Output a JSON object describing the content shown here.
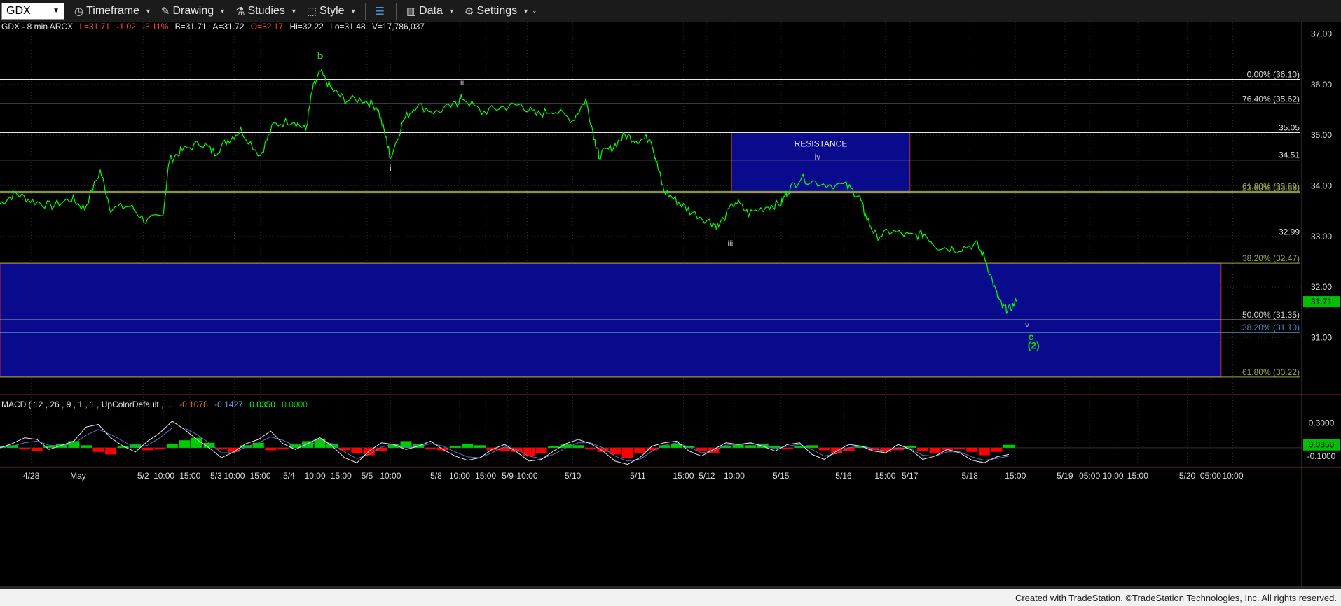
{
  "toolbar": {
    "symbol": "GDX",
    "timeframe_label": "Timeframe",
    "drawing_label": "Drawing",
    "studies_label": "Studies",
    "style_label": "Style",
    "data_label": "Data",
    "settings_label": "Settings"
  },
  "header": {
    "name": "GDX - 8 min  ARCX",
    "last": "L=31.71",
    "change": "-1.02",
    "pct": "-3.11%",
    "bid": "B=31.71",
    "ask": "A=31.72",
    "open": "O=32.17",
    "high": "Hi=32.22",
    "low": "Lo=31.48",
    "volume": "V=17,786,037"
  },
  "macd_header": {
    "label": "MACD ( 12 , 26 , 9 , 1 , 1 , UpColorDefault , ...",
    "v1": "-0.1078",
    "v2": "-0.1427",
    "v3": "0.0350",
    "v4": "0.0000"
  },
  "footer": {
    "text": "Created with TradeStation. ©TradeStation Technologies, Inc. All rights reserved."
  },
  "colors": {
    "price": "#00ff00",
    "zone": "#0a0a8c",
    "zone_border": "#c03030",
    "hist_up": "#00cc00",
    "hist_down": "#ff0000"
  },
  "chart_data": {
    "type": "line",
    "title": "GDX - 8 min",
    "ylim": [
      29.9,
      37.2
    ],
    "y_ticks": [
      {
        "value": 37.0,
        "label": "37.00"
      },
      {
        "value": 36.0,
        "label": "36.00"
      },
      {
        "value": 35.0,
        "label": "35.00"
      },
      {
        "value": 34.0,
        "label": "34.00"
      },
      {
        "value": 33.0,
        "label": "33.00"
      },
      {
        "value": 32.0,
        "label": "32.00"
      },
      {
        "value": 31.0,
        "label": "31.00"
      }
    ],
    "last_price": {
      "value": 31.71,
      "label": "31.71"
    },
    "x_ticks": [
      "4/28",
      "May",
      "5/2",
      "10:00",
      "15:00",
      "5/3",
      "10:00",
      "15:00",
      "5/4",
      "10:00",
      "15:00",
      "5/5",
      "10:00",
      "5/8",
      "10:00",
      "15:00",
      "5/9",
      "10:00",
      "5/10",
      "5/11",
      "15:00",
      "5/12",
      "10:00",
      "5/15",
      "5/16",
      "15:00",
      "5/17",
      "5/18",
      "15:00",
      "5/19",
      "05:00",
      "10:00",
      "15:00",
      "5/20",
      "05:00",
      "10:00"
    ],
    "series": [
      {
        "values": [
          [
            0,
            33.65
          ],
          [
            0.012,
            33.85
          ],
          [
            0.025,
            33.7
          ],
          [
            0.04,
            33.6
          ],
          [
            0.055,
            33.75
          ],
          [
            0.065,
            33.55
          ],
          [
            0.077,
            34.3
          ],
          [
            0.085,
            33.55
          ],
          [
            0.1,
            33.6
          ],
          [
            0.112,
            33.3
          ],
          [
            0.125,
            33.4
          ],
          [
            0.13,
            34.5
          ],
          [
            0.14,
            34.7
          ],
          [
            0.155,
            34.85
          ],
          [
            0.165,
            34.65
          ],
          [
            0.175,
            34.9
          ],
          [
            0.185,
            35.1
          ],
          [
            0.2,
            34.6
          ],
          [
            0.21,
            35.2
          ],
          [
            0.225,
            35.3
          ],
          [
            0.235,
            35.1
          ],
          [
            0.24,
            35.9
          ],
          [
            0.246,
            36.25
          ],
          [
            0.255,
            35.9
          ],
          [
            0.265,
            35.7
          ],
          [
            0.28,
            35.7
          ],
          [
            0.29,
            35.55
          ],
          [
            0.297,
            34.9
          ],
          [
            0.3,
            34.55
          ],
          [
            0.31,
            35.3
          ],
          [
            0.32,
            35.6
          ],
          [
            0.335,
            35.45
          ],
          [
            0.35,
            35.6
          ],
          [
            0.355,
            35.75
          ],
          [
            0.37,
            35.45
          ],
          [
            0.385,
            35.55
          ],
          [
            0.4,
            35.6
          ],
          [
            0.412,
            35.4
          ],
          [
            0.425,
            35.5
          ],
          [
            0.44,
            35.3
          ],
          [
            0.45,
            35.7
          ],
          [
            0.457,
            34.9
          ],
          [
            0.46,
            34.6
          ],
          [
            0.47,
            34.75
          ],
          [
            0.48,
            35.0
          ],
          [
            0.49,
            34.9
          ],
          [
            0.5,
            34.95
          ],
          [
            0.504,
            34.5
          ],
          [
            0.51,
            33.9
          ],
          [
            0.52,
            33.7
          ],
          [
            0.53,
            33.5
          ],
          [
            0.545,
            33.3
          ],
          [
            0.552,
            33.2
          ],
          [
            0.565,
            33.7
          ],
          [
            0.575,
            33.45
          ],
          [
            0.59,
            33.6
          ],
          [
            0.6,
            33.65
          ],
          [
            0.605,
            33.9
          ],
          [
            0.615,
            34.15
          ],
          [
            0.63,
            34.05
          ],
          [
            0.65,
            34.0
          ],
          [
            0.66,
            33.8
          ],
          [
            0.665,
            33.4
          ],
          [
            0.673,
            33.0
          ],
          [
            0.685,
            33.1
          ],
          [
            0.7,
            33.0
          ],
          [
            0.71,
            33.05
          ],
          [
            0.72,
            32.8
          ],
          [
            0.735,
            32.75
          ],
          [
            0.75,
            32.85
          ],
          [
            0.757,
            32.55
          ],
          [
            0.765,
            31.9
          ],
          [
            0.77,
            31.6
          ],
          [
            0.775,
            31.55
          ],
          [
            0.781,
            31.71
          ]
        ]
      }
    ],
    "horizontal_levels": [
      {
        "value": 36.1,
        "label": "0.00% (36.10)",
        "color": "#e8e8e8"
      },
      {
        "value": 35.62,
        "label": "76.40% (35.62)",
        "color": "#e8e8e8"
      },
      {
        "value": 35.05,
        "label": "35.05",
        "color": "#e8e8e8"
      },
      {
        "value": 34.51,
        "label": "34.51",
        "color": "#e8e8e8"
      },
      {
        "value": 33.89,
        "label": "61.80% (33.89)",
        "color": "#9aa84a"
      },
      {
        "value": 33.86,
        "label": "23.60% (33.86)",
        "color": "#9aa84a"
      },
      {
        "value": 32.99,
        "label": "32.99",
        "color": "#e8e8e8"
      },
      {
        "value": 32.47,
        "label": "38.20% (32.47)",
        "color": "#9aa84a"
      },
      {
        "value": 31.35,
        "label": "50.00% (31.35)",
        "color": "#cfcfcf"
      },
      {
        "value": 31.1,
        "label": "38.20% (31.10)",
        "color": "#4a90c0"
      },
      {
        "value": 30.22,
        "label": "61.80% (30.22)",
        "color": "#9aa84a"
      }
    ],
    "zones": [
      {
        "label": "RESISTANCE",
        "x_from": 0.562,
        "x_to": 0.699,
        "y_from": 33.86,
        "y_to": 35.05
      },
      {
        "label": "",
        "x_from": 0.0,
        "x_to": 0.938,
        "y_from": 30.22,
        "y_to": 32.47
      }
    ],
    "annotations": [
      {
        "text": "b",
        "x": 0.246,
        "y": 36.5,
        "color": "#3fbf3f"
      },
      {
        "text": "ii",
        "x": 0.355,
        "y": 35.98,
        "color": "#bbbbbb"
      },
      {
        "text": "i",
        "x": 0.3,
        "y": 34.3,
        "color": "#bbbbbb"
      },
      {
        "text": "iv",
        "x": 0.628,
        "y": 34.52,
        "color": "#bbbbbb"
      },
      {
        "text": "iii",
        "x": 0.561,
        "y": 32.8,
        "color": "#bbbbbb"
      },
      {
        "text": "v",
        "x": 0.789,
        "y": 31.2,
        "color": "#bbbbbb"
      },
      {
        "text": "c",
        "x": 0.792,
        "y": 30.95,
        "color": "#00e000"
      },
      {
        "text": "(2)",
        "x": 0.794,
        "y": 30.78,
        "color": "#00e000"
      }
    ],
    "macd": {
      "ylim": [
        -0.22,
        0.42
      ],
      "y_ticks": [
        {
          "value": 0.3,
          "label": "0.3000"
        },
        {
          "value": -0.1,
          "label": "-0.1000"
        }
      ],
      "last_value": {
        "value": 0.035,
        "label": "0.0350"
      },
      "histogram": [
        0.02,
        0.03,
        -0.02,
        -0.04,
        0.02,
        0.05,
        0.08,
        0.03,
        -0.05,
        -0.08,
        0.02,
        0.04,
        -0.03,
        -0.02,
        0.05,
        0.09,
        0.12,
        0.06,
        -0.02,
        -0.05,
        0.03,
        0.06,
        -0.03,
        -0.02,
        0.04,
        0.08,
        0.11,
        0.05,
        -0.03,
        -0.06,
        -0.09,
        -0.04,
        0.05,
        0.08,
        0.04,
        -0.02,
        -0.03,
        0.02,
        0.05,
        0.03,
        -0.03,
        -0.04,
        -0.05,
        -0.1,
        -0.06,
        0.02,
        0.04,
        0.03,
        -0.02,
        -0.05,
        -0.08,
        -0.12,
        -0.06,
        -0.03,
        0.03,
        0.05,
        0.02,
        -0.04,
        -0.06,
        0.02,
        0.04,
        0.03,
        0.05,
        0.02,
        -0.02,
        0.02,
        0.03,
        -0.03,
        -0.07,
        -0.04,
        0.02,
        -0.03,
        -0.05,
        -0.03,
        0.02,
        -0.04,
        -0.06,
        -0.03,
        -0.02,
        -0.05,
        -0.09,
        -0.05,
        0.035
      ],
      "macd_line": [
        0.0,
        0.05,
        0.12,
        0.1,
        -0.02,
        0.03,
        0.08,
        0.25,
        0.28,
        0.12,
        0.02,
        -0.05,
        0.08,
        0.18,
        0.32,
        0.22,
        0.1,
        0.0,
        -0.12,
        -0.05,
        0.05,
        0.1,
        0.2,
        0.05,
        -0.02,
        0.05,
        0.12,
        0.02,
        -0.12,
        -0.18,
        -0.04,
        0.06,
        0.04,
        -0.02,
        0.02,
        0.08,
        -0.02,
        -0.1,
        -0.15,
        -0.12,
        -0.02,
        0.04,
        -0.05,
        -0.16,
        -0.14,
        -0.04,
        0.05,
        0.1,
        0.05,
        -0.04,
        -0.16,
        -0.2,
        -0.12,
        0.02,
        0.06,
        0.08,
        -0.04,
        -0.1,
        -0.02,
        0.06,
        0.04,
        0.06,
        0.02,
        -0.04,
        0.04,
        0.06,
        -0.08,
        -0.14,
        -0.04,
        0.04,
        0.02,
        -0.04,
        -0.06,
        0.04,
        -0.02,
        -0.14,
        -0.1,
        -0.02,
        -0.06,
        -0.15,
        -0.18,
        -0.11,
        -0.08
      ],
      "signal_line": [
        0.0,
        0.02,
        0.06,
        0.08,
        0.03,
        0.02,
        0.05,
        0.15,
        0.22,
        0.16,
        0.08,
        0.0,
        0.03,
        0.12,
        0.24,
        0.24,
        0.16,
        0.06,
        -0.06,
        -0.06,
        0.01,
        0.06,
        0.13,
        0.09,
        0.02,
        0.03,
        0.08,
        0.05,
        -0.05,
        -0.13,
        -0.08,
        0.01,
        0.04,
        0.01,
        0.01,
        0.05,
        0.02,
        -0.05,
        -0.11,
        -0.12,
        -0.06,
        0.01,
        -0.02,
        -0.1,
        -0.13,
        -0.08,
        0.0,
        0.06,
        0.06,
        0.0,
        -0.1,
        -0.16,
        -0.14,
        -0.04,
        0.03,
        0.06,
        0.01,
        -0.06,
        -0.04,
        0.03,
        0.04,
        0.05,
        0.03,
        -0.01,
        0.02,
        0.04,
        -0.02,
        -0.1,
        -0.07,
        0.0,
        0.02,
        -0.01,
        -0.04,
        0.0,
        -0.01,
        -0.09,
        -0.1,
        -0.05,
        -0.05,
        -0.11,
        -0.15,
        -0.13,
        -0.1
      ]
    }
  }
}
